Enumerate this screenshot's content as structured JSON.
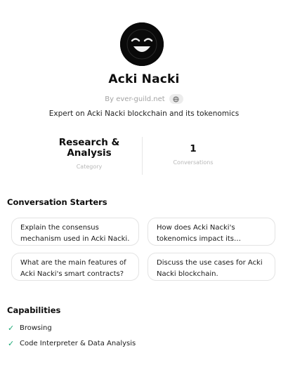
{
  "gpt": {
    "name": "Acki Nacki",
    "byline": "By ever-guild.net",
    "description": "Expert on Acki Nacki blockchain and its tokenomics"
  },
  "stats": {
    "category": {
      "value": "Research & Analysis",
      "label": "Category"
    },
    "conversations": {
      "value": "1",
      "label": "Conversations"
    }
  },
  "starters": {
    "title": "Conversation Starters",
    "items": [
      "Explain the consensus mechanism used in Acki Nacki.",
      "How does Acki Nacki's tokenomics impact its ecosystem?",
      "What are the main features of Acki Nacki's smart contracts?",
      "Discuss the use cases for Acki Nacki blockchain."
    ]
  },
  "capabilities": {
    "title": "Capabilities",
    "items": [
      "Browsing",
      "Code Interpreter & Data Analysis"
    ]
  },
  "colors": {
    "check": "#19a874",
    "muted": "#a3a3a3",
    "border": "#e3e3e3"
  },
  "icons": [
    "smiley-avatar",
    "globe-icon",
    "check-icon"
  ]
}
